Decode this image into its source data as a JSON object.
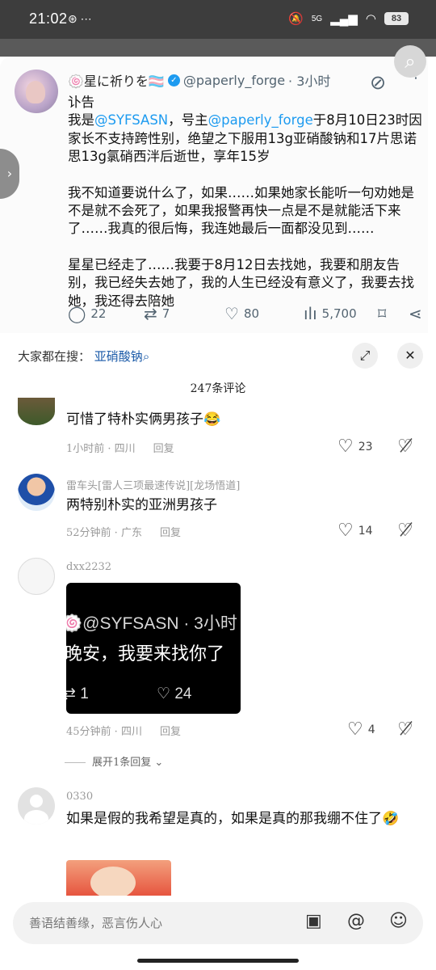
{
  "status_bar": {
    "time": "21:02",
    "left_icons": "⊛  ⋯",
    "network": "5G",
    "battery": "83"
  },
  "tweet": {
    "display_name": "🍥星に祈りを🏳️‍⚧️",
    "handle": "@paperly_forge",
    "time": "· 3小时",
    "line1": "讣告",
    "p1_pre": "我是",
    "p1_mention1": "@SYFSASN",
    "p1_mid": "，号主",
    "p1_mention2": "@paperly_forge",
    "p1_post": "于8月10日23时因家长不支持跨性别，绝望之下服用13g亚硝酸钠和17片思诺思13g氯硝西泮后逝世，享年15岁",
    "p2": "我不知道要说什么了，如果……如果她家长能听一句劝她是不是就不会死了，如果我报警再快一点是不是就能活下来了……我真的很后悔，我连她最后一面都没见到……",
    "p3": "星星已经走了……我要于8月12日去找她，我要和朋友告别，我已经失去她了，我的人生已经没有意义了，我要去找她，我还得去陪她",
    "replies": "22",
    "retweets": "7",
    "likes": "80",
    "views": "5,700"
  },
  "sheet": {
    "search_label": "大家都在搜：",
    "search_keyword": "亚硝酸钠",
    "comment_count": "247条评论"
  },
  "comments": [
    {
      "text": "可惜了特朴实俩男孩子😂",
      "time": "1小时前 · 四川",
      "reply_label": "回复",
      "likes": "23"
    },
    {
      "user": "雷车头[雷人三项最速传说][龙场悟道]",
      "text": "两特别朴实的亚洲男孩子",
      "time": "52分钟前 · 广东",
      "reply_label": "回复",
      "likes": "14"
    },
    {
      "user": "dxx2232",
      "embed_line1": "🍥@SYFSASN · 3小时",
      "embed_line2": "晚安，我要来找你了",
      "embed_retweets": "1",
      "embed_likes": "24",
      "time": "45分钟前 · 四川",
      "reply_label": "回复",
      "likes": "4",
      "expand_label": "展开1条回复"
    },
    {
      "user": "0330",
      "text": "如果是假的我希望是真的，如果是真的那我绷不住了🤣"
    }
  ],
  "input": {
    "placeholder": "善语结善缘，恶言伤人心"
  },
  "colors": {
    "link": "#1d9bf0",
    "keyword": "#1a5aa8",
    "status_bar": "#3d3d3d"
  },
  "icons": [
    "search-icon",
    "grok-icon",
    "more-icon",
    "reply-icon",
    "retweet-icon",
    "like-icon",
    "views-icon",
    "bookmark-icon",
    "share-icon",
    "expand-icon",
    "close-icon",
    "heart-icon",
    "dislike-icon",
    "image-icon",
    "at-icon",
    "emoji-icon"
  ]
}
